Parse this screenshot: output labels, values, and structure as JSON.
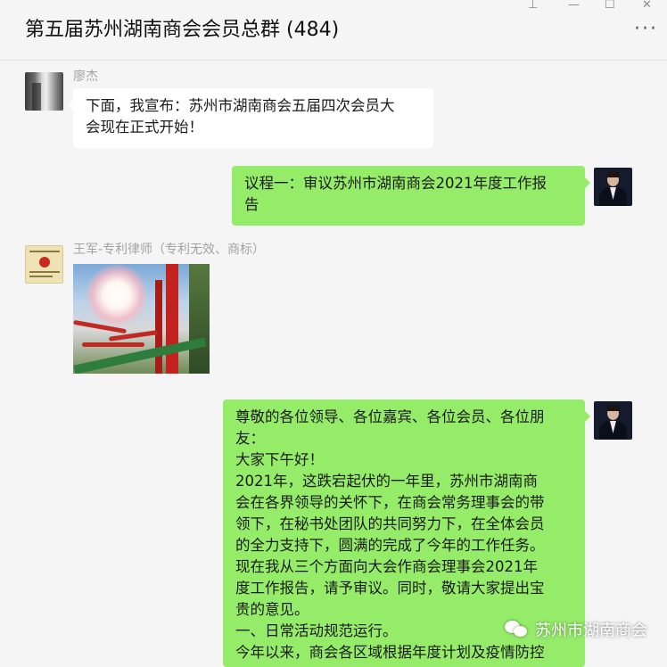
{
  "window": {
    "title": "第五届苏州湖南商会会员总群 (484)",
    "controls": {
      "pin": "⊥",
      "minimize": "—",
      "maximize": "☐",
      "close": "✕"
    },
    "more": "···"
  },
  "messages": [
    {
      "side": "left",
      "sender": "廖杰",
      "avatar": "hall-photo-avatar",
      "text": "下面，我宣布：苏州市湖南商会五届四次会员大\n会现在正式开始！"
    },
    {
      "side": "right",
      "avatar": "man-in-suit-avatar",
      "text": "议程一：审议苏州市湖南商会2021年度工作报\n告"
    },
    {
      "side": "left",
      "sender": "王军-专利律师（专利无效、商标）",
      "avatar": "certificate-avatar",
      "image": "red-lanterns-celebration-photo"
    },
    {
      "side": "right",
      "avatar": "man-in-suit-avatar",
      "text": "尊敬的各位领导、各位嘉宾、各位会员、各位朋\n友：\n大家下午好！\n2021年，这跌宕起伏的一年里，苏州市湖南商\n会在各界领导的关怀下，在商会常务理事会的带\n领下，在秘书处团队的共同努力下，在全体会员\n的全力支持下，圆满的完成了今年的工作任务。\n现在我从三个方面向大会作商会理事会2021年\n度工作报告，请予审议。同时，敬请大家提出宝\n贵的意见。\n一、日常活动规范运行。\n今年以来，商会各区域根据年度计划及疫情防控"
    }
  ],
  "watermark": {
    "text": "苏州市湖南商会",
    "icon": "wechat-icon"
  },
  "colors": {
    "background": "#f5f5f5",
    "bubble_self": "#95ec69",
    "bubble_other": "#ffffff",
    "sender_name": "#a3a3a3"
  }
}
